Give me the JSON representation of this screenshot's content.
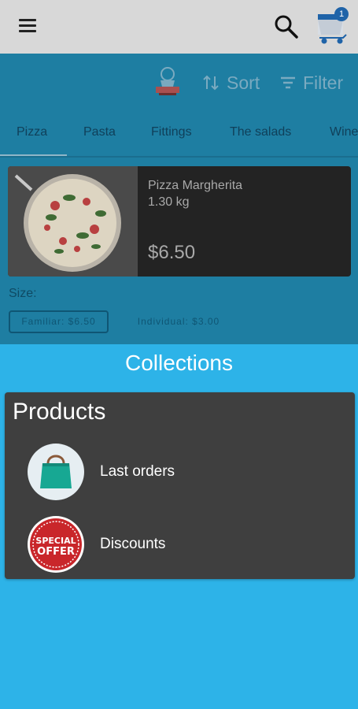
{
  "toolbar": {
    "sort_label": "Sort",
    "filter_label": "Filter",
    "cart_count": "1"
  },
  "tabs": [
    {
      "label": "Pizza"
    },
    {
      "label": "Pasta"
    },
    {
      "label": "Fittings"
    },
    {
      "label": "The salads"
    },
    {
      "label": "Wine"
    }
  ],
  "product": {
    "name": "Pizza Margherita",
    "weight": "1.30 kg",
    "price": "$6.50",
    "size_label": "Size:",
    "sizes": [
      {
        "label": "Familiar: $6.50",
        "selected": true
      },
      {
        "label": "Individual: $3.00",
        "selected": false
      }
    ]
  },
  "sheet": {
    "title": "Collections",
    "section_title": "Products",
    "items": [
      {
        "label": "Last orders",
        "icon": "shopping-bag-icon"
      },
      {
        "label": "Discounts",
        "icon": "special-offer-icon",
        "icon_text_1": "SPECIAL",
        "icon_text_2": "OFFER"
      }
    ]
  },
  "colors": {
    "background": "#2db3e8",
    "panel": "#3f3f3f",
    "appbar": "#d8d8d8",
    "dim_overlay": "#1e7ea2"
  }
}
